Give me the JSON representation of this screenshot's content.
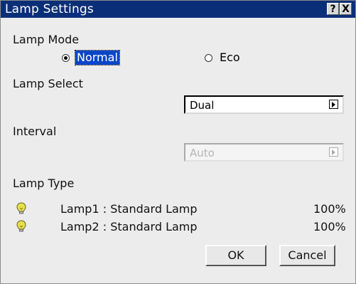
{
  "window": {
    "title": "Lamp Settings",
    "help_label": "?",
    "close_label": "X"
  },
  "lamp_mode": {
    "label": "Lamp Mode",
    "options": [
      {
        "label": "Normal",
        "selected": true
      },
      {
        "label": "Eco",
        "selected": false
      }
    ]
  },
  "lamp_select": {
    "label": "Lamp Select",
    "value": "Dual"
  },
  "interval": {
    "label": "Interval",
    "value": "Auto",
    "disabled": true
  },
  "lamp_type": {
    "label": "Lamp Type",
    "lamps": [
      {
        "name": "Lamp1 : Standard Lamp",
        "percent": "100%",
        "icon": "lightbulb-icon"
      },
      {
        "name": "Lamp2 : Standard Lamp",
        "percent": "100%",
        "icon": "lightbulb-icon"
      }
    ]
  },
  "buttons": {
    "ok": "OK",
    "cancel": "Cancel"
  },
  "colors": {
    "titlebar": "#0a2f78",
    "selection": "#0a46c8",
    "bulb": "#e8e04a"
  }
}
